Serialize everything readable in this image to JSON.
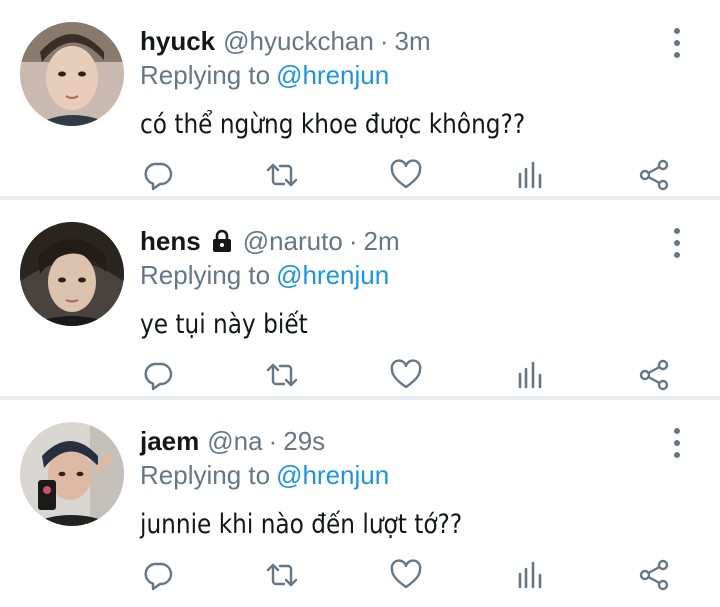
{
  "tweets": [
    {
      "name": "hyuck",
      "handle": "@hyuckchan",
      "dot": "·",
      "time": "3m",
      "replying_label": "Replying to",
      "replying_to": "@hrenjun",
      "text": "có thể ngừng khoe được không??",
      "locked": false
    },
    {
      "name": "hens",
      "handle": "@naruto",
      "dot": "·",
      "time": "2m",
      "replying_label": "Replying to",
      "replying_to": "@hrenjun",
      "text": "ye tụi này biết",
      "locked": true
    },
    {
      "name": "jaem",
      "handle": "@na",
      "dot": "·",
      "time": "29s",
      "replying_label": "Replying to",
      "replying_to": "@hrenjun",
      "text": "junnie khi nào đến lượt tớ??",
      "locked": false
    }
  ],
  "icons": [
    "reply-icon",
    "retweet-icon",
    "like-icon",
    "stats-icon",
    "share-icon",
    "more-icon",
    "lock-icon"
  ],
  "colors": {
    "text": "#14171a",
    "secondary": "#657786",
    "mention": "#1b95e0",
    "divider": "#e6ecf0"
  }
}
